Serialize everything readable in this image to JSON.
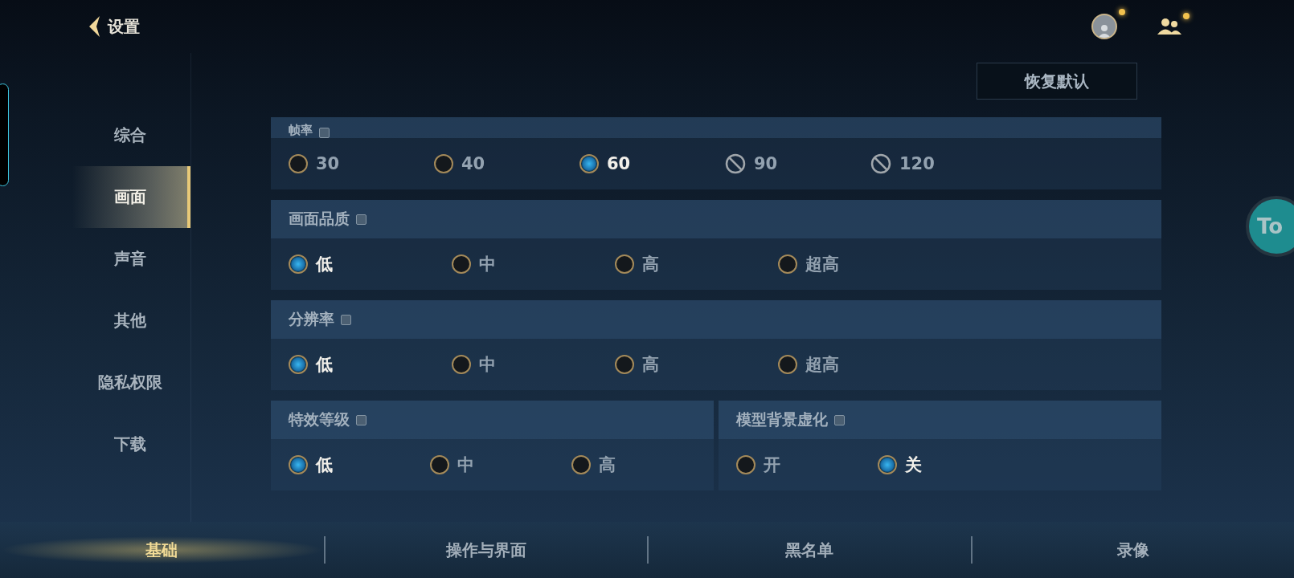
{
  "header": {
    "back_label": "设置",
    "reset_button": "恢复默认"
  },
  "floating_button": {
    "label": "To"
  },
  "sidebar": {
    "items": [
      {
        "label": "综合",
        "selected": false
      },
      {
        "label": "画面",
        "selected": true
      },
      {
        "label": "声音",
        "selected": false
      },
      {
        "label": "其他",
        "selected": false
      },
      {
        "label": "隐私权限",
        "selected": false
      },
      {
        "label": "下载",
        "selected": false
      }
    ]
  },
  "sections": [
    {
      "title": "帧率",
      "options": [
        {
          "label": "30",
          "kind": "radio",
          "selected": false
        },
        {
          "label": "40",
          "kind": "radio",
          "selected": false
        },
        {
          "label": "60",
          "kind": "radio",
          "selected": true
        },
        {
          "label": "90",
          "kind": "disabled"
        },
        {
          "label": "120",
          "kind": "disabled"
        }
      ]
    },
    {
      "title": "画面品质",
      "options": [
        {
          "label": "低",
          "kind": "radio",
          "selected": true
        },
        {
          "label": "中",
          "kind": "radio",
          "selected": false
        },
        {
          "label": "高",
          "kind": "radio",
          "selected": false
        },
        {
          "label": "超高",
          "kind": "radio",
          "selected": false
        }
      ]
    },
    {
      "title": "分辨率",
      "options": [
        {
          "label": "低",
          "kind": "radio",
          "selected": true
        },
        {
          "label": "中",
          "kind": "radio",
          "selected": false
        },
        {
          "label": "高",
          "kind": "radio",
          "selected": false
        },
        {
          "label": "超高",
          "kind": "radio",
          "selected": false
        }
      ]
    }
  ],
  "split_sections": [
    {
      "title": "特效等级",
      "options": [
        {
          "label": "低",
          "kind": "radio",
          "selected": true
        },
        {
          "label": "中",
          "kind": "radio",
          "selected": false
        },
        {
          "label": "高",
          "kind": "radio",
          "selected": false
        }
      ]
    },
    {
      "title": "模型背景虚化",
      "options": [
        {
          "label": "开",
          "kind": "radio",
          "selected": false
        },
        {
          "label": "关",
          "kind": "radio",
          "selected": true
        }
      ]
    }
  ],
  "bottom_tabs": [
    {
      "label": "基础",
      "selected": true
    },
    {
      "label": "操作与界面",
      "selected": false
    },
    {
      "label": "黑名单",
      "selected": false
    },
    {
      "label": "录像",
      "selected": false
    }
  ]
}
